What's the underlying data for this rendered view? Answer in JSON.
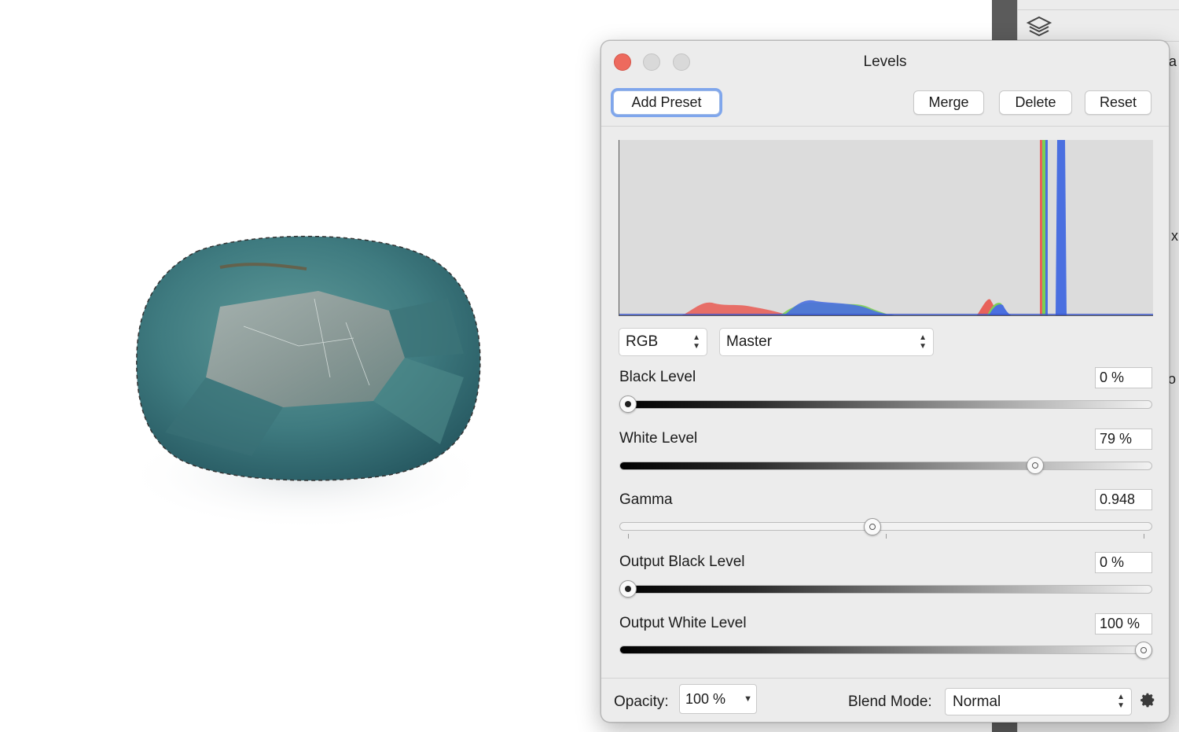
{
  "window": {
    "title": "Levels"
  },
  "toolbar": {
    "add_preset_label": "Add Preset",
    "merge_label": "Merge",
    "delete_label": "Delete",
    "reset_label": "Reset"
  },
  "histogram": {
    "channels_shown": [
      "red",
      "green",
      "blue"
    ]
  },
  "channel_select": {
    "value": "RGB"
  },
  "mode_select": {
    "value": "Master"
  },
  "controls": {
    "black_level": {
      "label": "Black Level",
      "value_text": "0 %",
      "value": 0
    },
    "white_level": {
      "label": "White Level",
      "value_text": "79 %",
      "value": 79
    },
    "gamma": {
      "label": "Gamma",
      "value_text": "0.948",
      "value": 0.948
    },
    "output_black_level": {
      "label": "Output Black Level",
      "value_text": "0 %",
      "value": 0
    },
    "output_white_level": {
      "label": "Output White Level",
      "value_text": "100 %",
      "value": 100
    }
  },
  "footer": {
    "opacity_label": "Opacity:",
    "opacity_value": "100 %",
    "blend_label": "Blend Mode:",
    "blend_value": "Normal"
  },
  "side_panel": {
    "peek_chars": [
      "a",
      "x",
      "o"
    ]
  },
  "colors": {
    "close": "#ed6a5e",
    "focus_ring": "#7fa6ec",
    "hist_red": "#e8625a",
    "hist_green": "#7ccf55",
    "hist_blue": "#4a6fe0"
  },
  "icons": [
    "layers-icon",
    "gear-icon",
    "close-icon",
    "minimize-icon",
    "zoom-icon"
  ]
}
